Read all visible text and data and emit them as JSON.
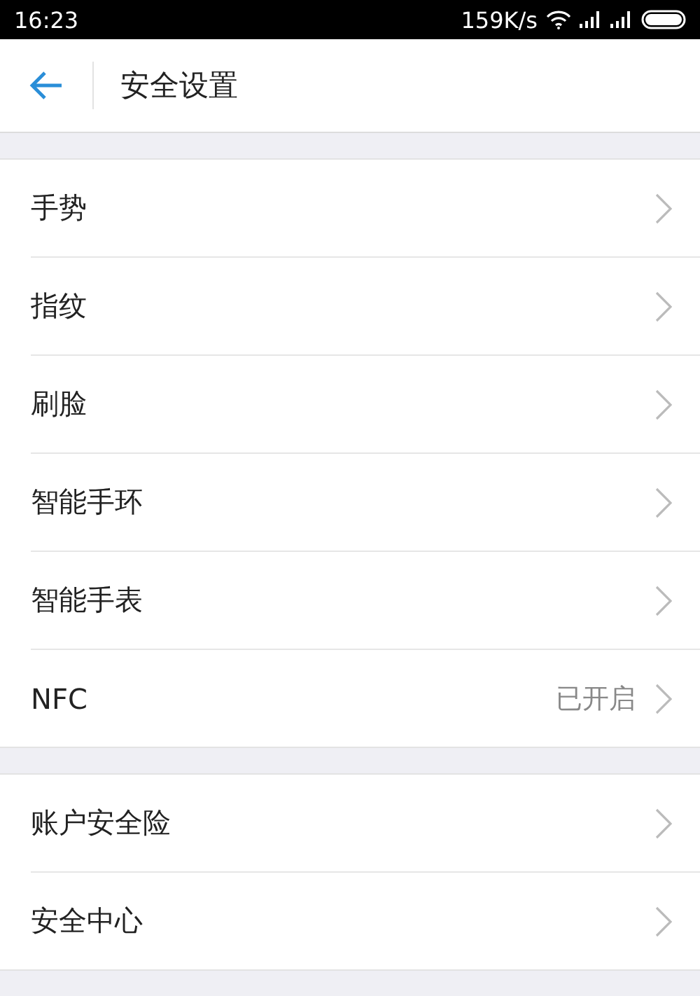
{
  "status_bar": {
    "time": "16:23",
    "speed": "159K/s"
  },
  "header": {
    "title": "安全设置"
  },
  "groups": [
    {
      "items": [
        {
          "label": "手势"
        },
        {
          "label": "指纹"
        },
        {
          "label": "刷脸"
        },
        {
          "label": "智能手环"
        },
        {
          "label": "智能手表"
        },
        {
          "label": "NFC",
          "value": "已开启"
        }
      ]
    },
    {
      "items": [
        {
          "label": "账户安全险"
        },
        {
          "label": "安全中心"
        }
      ]
    }
  ]
}
